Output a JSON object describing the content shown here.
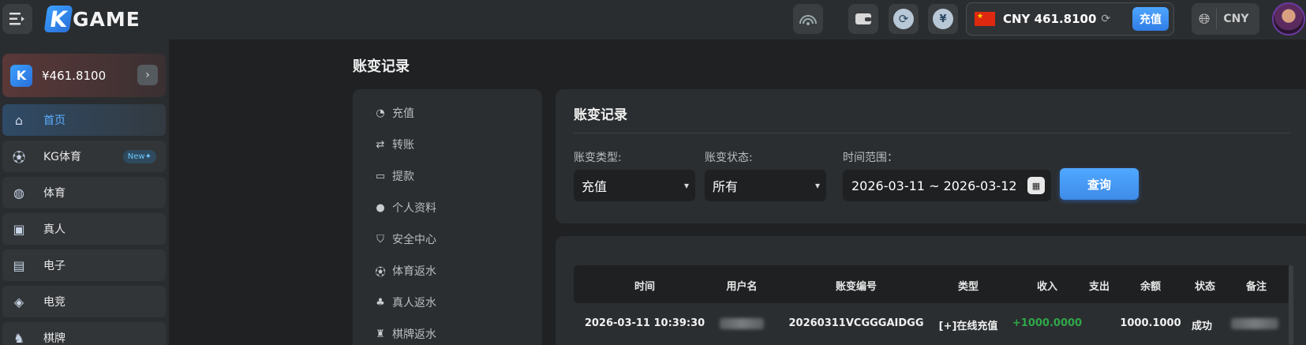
{
  "header": {
    "logo_text": "GAME",
    "logo_k": "K",
    "balance": "CNY 461.8100",
    "topup_label": "充值",
    "currency": "CNY",
    "icons": [
      "menu-icon",
      "signal-icon",
      "wallet-icon",
      "refresh-icon",
      "yuan-icon",
      "globe-icon"
    ]
  },
  "sidebar": {
    "wallet_amount": "¥461.8100",
    "wallet_logo": "K",
    "items": [
      {
        "label": "首页",
        "icon": "home-icon",
        "active": true
      },
      {
        "label": "KG体育",
        "icon": "football-icon",
        "badge": "New✦"
      },
      {
        "label": "体育",
        "icon": "basketball-icon"
      },
      {
        "label": "真人",
        "icon": "live-card-icon"
      },
      {
        "label": "电子",
        "icon": "slot-machine-icon"
      },
      {
        "label": "电竞",
        "icon": "gamepad-icon"
      },
      {
        "label": "棋牌",
        "icon": "chess-icon"
      }
    ]
  },
  "page": {
    "title": "账变记录"
  },
  "submenu": {
    "items": [
      {
        "label": "充值",
        "icon": "piggy-bank-icon"
      },
      {
        "label": "转账",
        "icon": "transfer-icon"
      },
      {
        "label": "提款",
        "icon": "withdraw-icon"
      },
      {
        "label": "个人资料",
        "icon": "user-icon"
      },
      {
        "label": "安全中心",
        "icon": "shield-icon"
      },
      {
        "label": "体育返水",
        "icon": "soccer-ball-icon"
      },
      {
        "label": "真人返水",
        "icon": "people-icon"
      },
      {
        "label": "棋牌返水",
        "icon": "chess-piece-icon"
      }
    ]
  },
  "filter": {
    "title": "账变记录",
    "type_label": "账变类型:",
    "type_value": "充值",
    "status_label": "账变状态:",
    "status_value": "所有",
    "range_label": "时间范围：",
    "range_value": "2026-03-11 ~ 2026-03-12",
    "query_label": "查询"
  },
  "table": {
    "columns": [
      "时间",
      "用户名",
      "账变编号",
      "类型",
      "收入",
      "支出",
      "余额",
      "状态",
      "备注"
    ],
    "rows": [
      {
        "time": "2026-03-11 10:39:30",
        "username": "",
        "serial": "20260311VCGGGAIDGG",
        "type": "[+]在线充值",
        "income": "+1000.0000",
        "expense": "",
        "balance": "1000.1000",
        "status": "成功",
        "remark": ""
      }
    ]
  }
}
